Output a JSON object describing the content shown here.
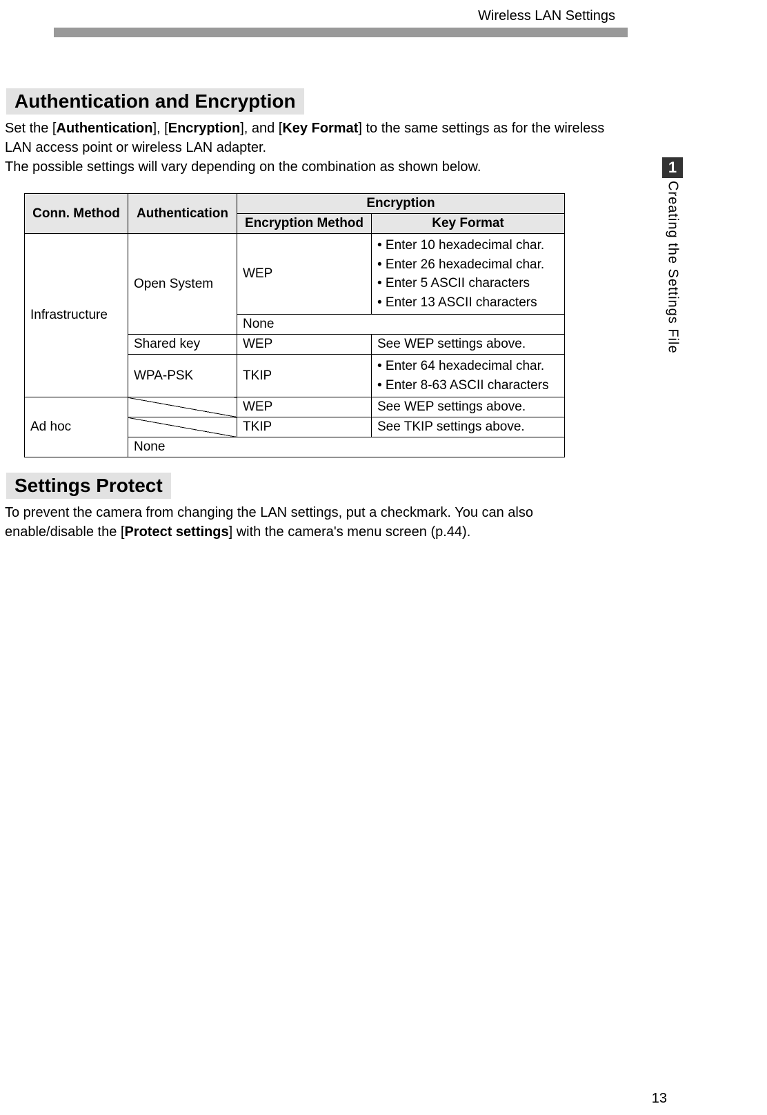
{
  "header": {
    "title": "Wireless LAN Settings"
  },
  "tab": {
    "number": "1",
    "label": "Creating the Settings File"
  },
  "section1": {
    "heading": "Authentication and Encryption",
    "intro_pre": "Set the [",
    "b1": "Authentication",
    "intro_mid1": "], [",
    "b2": "Encryption",
    "intro_mid2": "], and [",
    "b3": "Key Format",
    "intro_post1": "] to the same settings as for the wireless LAN access point or wireless LAN adapter.",
    "intro_line2": "The possible settings will vary depending on the combination as shown below."
  },
  "table": {
    "h_conn": "Conn. Method",
    "h_auth": "Authentication",
    "h_enc": "Encryption",
    "h_encm": "Encryption Method",
    "h_keyf": "Key Format",
    "r_infra": "Infrastructure",
    "r_open": "Open System",
    "r_wep": "WEP",
    "wep_k1": "• Enter 10 hexadecimal char.",
    "wep_k2": "• Enter 26 hexadecimal char.",
    "wep_k3": "• Enter 5 ASCII characters",
    "wep_k4": "• Enter 13 ASCII characters",
    "r_none": "None",
    "r_shared": "Shared key",
    "r_wep2": "WEP",
    "r_seewep": "See WEP settings above.",
    "r_wpapsk": "WPA-PSK",
    "r_tkip": "TKIP",
    "tkip_k1": "• Enter 64 hexadecimal char.",
    "tkip_k2": "• Enter 8-63 ASCII characters",
    "r_adhoc": "Ad hoc",
    "r_wep3": "WEP",
    "r_seewep2": "See WEP settings above.",
    "r_tkip2": "TKIP",
    "r_seetkip": "See TKIP settings above.",
    "r_none2": "None"
  },
  "section2": {
    "heading": "Settings Protect",
    "body_pre": "To prevent the camera from changing the LAN settings, put a checkmark. You can also enable/disable the [",
    "b1": "Protect settings",
    "body_post": "] with the camera's menu screen (p.44)."
  },
  "page_number": "13"
}
